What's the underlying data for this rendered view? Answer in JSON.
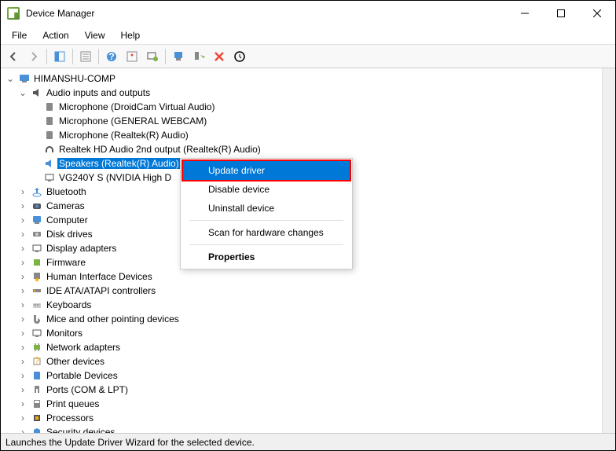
{
  "window": {
    "title": "Device Manager"
  },
  "menubar": [
    "File",
    "Action",
    "View",
    "Help"
  ],
  "tree": {
    "root": "HIMANSHU-COMP",
    "audio": {
      "label": "Audio inputs and outputs",
      "children": [
        "Microphone (DroidCam Virtual Audio)",
        "Microphone (GENERAL WEBCAM)",
        "Microphone (Realtek(R) Audio)",
        "Realtek HD Audio 2nd output (Realtek(R) Audio)",
        "Speakers (Realtek(R) Audio)",
        "VG240Y S (NVIDIA High D"
      ]
    },
    "categories": [
      "Bluetooth",
      "Cameras",
      "Computer",
      "Disk drives",
      "Display adapters",
      "Firmware",
      "Human Interface Devices",
      "IDE ATA/ATAPI controllers",
      "Keyboards",
      "Mice and other pointing devices",
      "Monitors",
      "Network adapters",
      "Other devices",
      "Portable Devices",
      "Ports (COM & LPT)",
      "Print queues",
      "Processors",
      "Security devices"
    ]
  },
  "context_menu": {
    "update": "Update driver",
    "disable": "Disable device",
    "uninstall": "Uninstall device",
    "scan": "Scan for hardware changes",
    "properties": "Properties"
  },
  "statusbar": "Launches the Update Driver Wizard for the selected device."
}
